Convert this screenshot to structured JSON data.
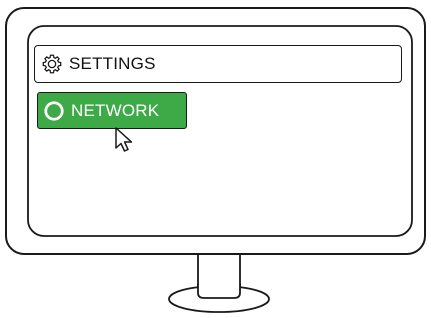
{
  "menu": {
    "settings": {
      "label": "SETTINGS",
      "icon": "gear-icon"
    },
    "network": {
      "label": "NETWORK",
      "icon": "circle-ring-icon",
      "state": "hover"
    }
  },
  "cursor": {
    "icon": "mouse-pointer-icon"
  },
  "colors": {
    "accent": "#3daa47",
    "stroke": "#1a1a1a",
    "background": "#ffffff"
  }
}
